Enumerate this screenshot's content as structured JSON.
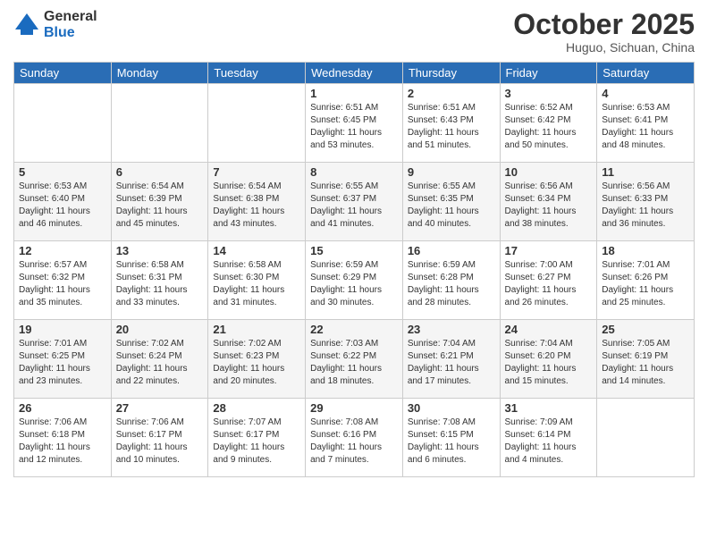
{
  "logo": {
    "general": "General",
    "blue": "Blue"
  },
  "title": "October 2025",
  "location": "Huguo, Sichuan, China",
  "weekdays": [
    "Sunday",
    "Monday",
    "Tuesday",
    "Wednesday",
    "Thursday",
    "Friday",
    "Saturday"
  ],
  "weeks": [
    [
      {
        "day": "",
        "info": ""
      },
      {
        "day": "",
        "info": ""
      },
      {
        "day": "",
        "info": ""
      },
      {
        "day": "1",
        "info": "Sunrise: 6:51 AM\nSunset: 6:45 PM\nDaylight: 11 hours\nand 53 minutes."
      },
      {
        "day": "2",
        "info": "Sunrise: 6:51 AM\nSunset: 6:43 PM\nDaylight: 11 hours\nand 51 minutes."
      },
      {
        "day": "3",
        "info": "Sunrise: 6:52 AM\nSunset: 6:42 PM\nDaylight: 11 hours\nand 50 minutes."
      },
      {
        "day": "4",
        "info": "Sunrise: 6:53 AM\nSunset: 6:41 PM\nDaylight: 11 hours\nand 48 minutes."
      }
    ],
    [
      {
        "day": "5",
        "info": "Sunrise: 6:53 AM\nSunset: 6:40 PM\nDaylight: 11 hours\nand 46 minutes."
      },
      {
        "day": "6",
        "info": "Sunrise: 6:54 AM\nSunset: 6:39 PM\nDaylight: 11 hours\nand 45 minutes."
      },
      {
        "day": "7",
        "info": "Sunrise: 6:54 AM\nSunset: 6:38 PM\nDaylight: 11 hours\nand 43 minutes."
      },
      {
        "day": "8",
        "info": "Sunrise: 6:55 AM\nSunset: 6:37 PM\nDaylight: 11 hours\nand 41 minutes."
      },
      {
        "day": "9",
        "info": "Sunrise: 6:55 AM\nSunset: 6:35 PM\nDaylight: 11 hours\nand 40 minutes."
      },
      {
        "day": "10",
        "info": "Sunrise: 6:56 AM\nSunset: 6:34 PM\nDaylight: 11 hours\nand 38 minutes."
      },
      {
        "day": "11",
        "info": "Sunrise: 6:56 AM\nSunset: 6:33 PM\nDaylight: 11 hours\nand 36 minutes."
      }
    ],
    [
      {
        "day": "12",
        "info": "Sunrise: 6:57 AM\nSunset: 6:32 PM\nDaylight: 11 hours\nand 35 minutes."
      },
      {
        "day": "13",
        "info": "Sunrise: 6:58 AM\nSunset: 6:31 PM\nDaylight: 11 hours\nand 33 minutes."
      },
      {
        "day": "14",
        "info": "Sunrise: 6:58 AM\nSunset: 6:30 PM\nDaylight: 11 hours\nand 31 minutes."
      },
      {
        "day": "15",
        "info": "Sunrise: 6:59 AM\nSunset: 6:29 PM\nDaylight: 11 hours\nand 30 minutes."
      },
      {
        "day": "16",
        "info": "Sunrise: 6:59 AM\nSunset: 6:28 PM\nDaylight: 11 hours\nand 28 minutes."
      },
      {
        "day": "17",
        "info": "Sunrise: 7:00 AM\nSunset: 6:27 PM\nDaylight: 11 hours\nand 26 minutes."
      },
      {
        "day": "18",
        "info": "Sunrise: 7:01 AM\nSunset: 6:26 PM\nDaylight: 11 hours\nand 25 minutes."
      }
    ],
    [
      {
        "day": "19",
        "info": "Sunrise: 7:01 AM\nSunset: 6:25 PM\nDaylight: 11 hours\nand 23 minutes."
      },
      {
        "day": "20",
        "info": "Sunrise: 7:02 AM\nSunset: 6:24 PM\nDaylight: 11 hours\nand 22 minutes."
      },
      {
        "day": "21",
        "info": "Sunrise: 7:02 AM\nSunset: 6:23 PM\nDaylight: 11 hours\nand 20 minutes."
      },
      {
        "day": "22",
        "info": "Sunrise: 7:03 AM\nSunset: 6:22 PM\nDaylight: 11 hours\nand 18 minutes."
      },
      {
        "day": "23",
        "info": "Sunrise: 7:04 AM\nSunset: 6:21 PM\nDaylight: 11 hours\nand 17 minutes."
      },
      {
        "day": "24",
        "info": "Sunrise: 7:04 AM\nSunset: 6:20 PM\nDaylight: 11 hours\nand 15 minutes."
      },
      {
        "day": "25",
        "info": "Sunrise: 7:05 AM\nSunset: 6:19 PM\nDaylight: 11 hours\nand 14 minutes."
      }
    ],
    [
      {
        "day": "26",
        "info": "Sunrise: 7:06 AM\nSunset: 6:18 PM\nDaylight: 11 hours\nand 12 minutes."
      },
      {
        "day": "27",
        "info": "Sunrise: 7:06 AM\nSunset: 6:17 PM\nDaylight: 11 hours\nand 10 minutes."
      },
      {
        "day": "28",
        "info": "Sunrise: 7:07 AM\nSunset: 6:17 PM\nDaylight: 11 hours\nand 9 minutes."
      },
      {
        "day": "29",
        "info": "Sunrise: 7:08 AM\nSunset: 6:16 PM\nDaylight: 11 hours\nand 7 minutes."
      },
      {
        "day": "30",
        "info": "Sunrise: 7:08 AM\nSunset: 6:15 PM\nDaylight: 11 hours\nand 6 minutes."
      },
      {
        "day": "31",
        "info": "Sunrise: 7:09 AM\nSunset: 6:14 PM\nDaylight: 11 hours\nand 4 minutes."
      },
      {
        "day": "",
        "info": ""
      }
    ]
  ]
}
